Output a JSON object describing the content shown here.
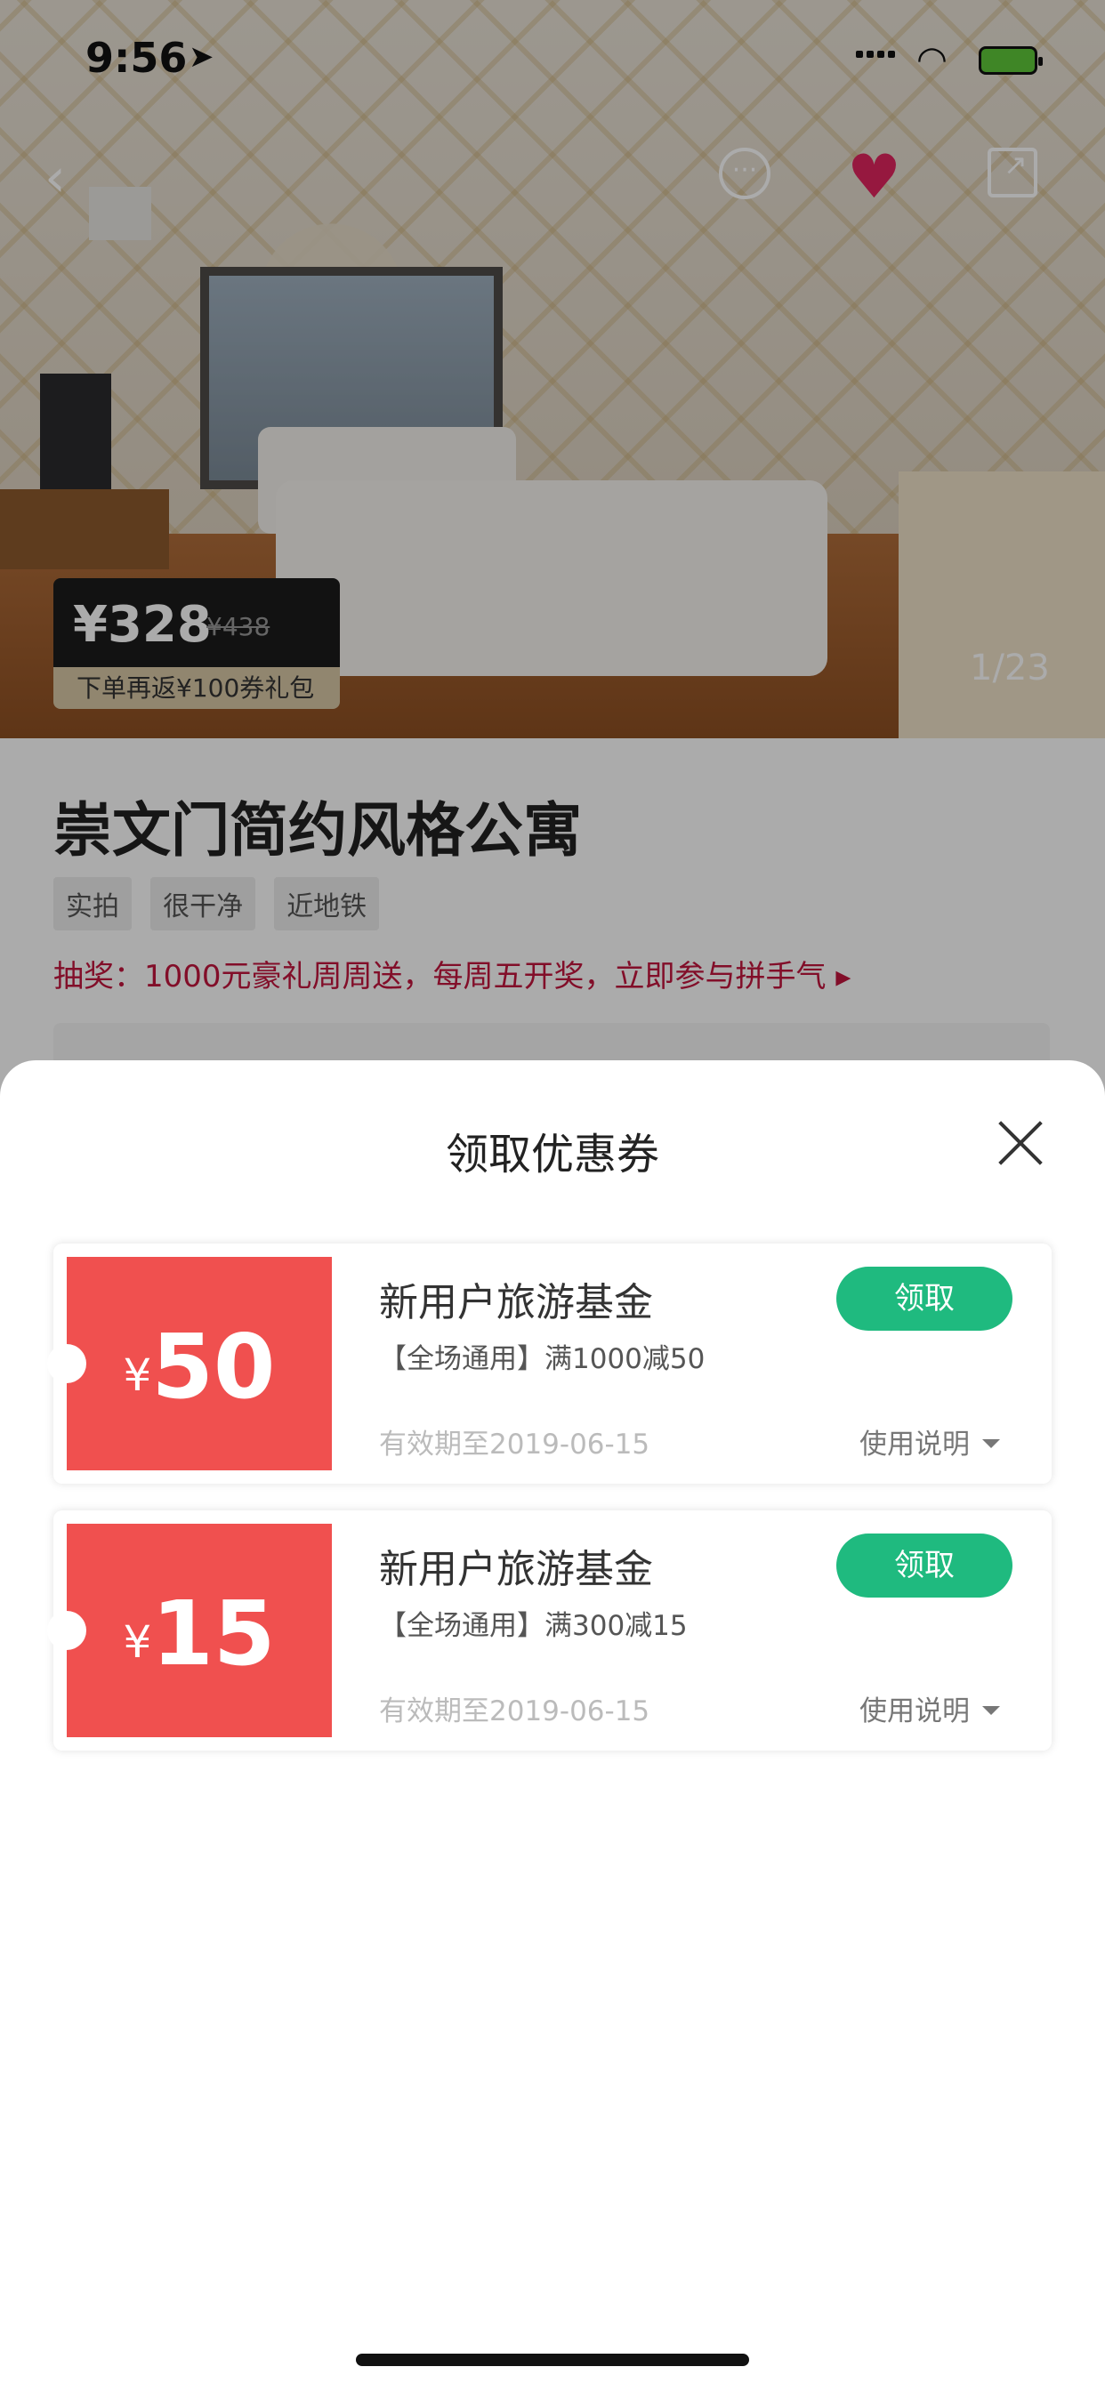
{
  "status_bar": {
    "time": "9:56"
  },
  "listing": {
    "price_current": "¥328",
    "price_original": "¥438",
    "price_note": "下单再返¥100券礼包",
    "photo_counter": "1/23",
    "title": "崇文门简约风格公寓",
    "tags": [
      "实拍",
      "很干净",
      "近地铁"
    ],
    "lottery_text": "抽奖：1000元豪礼周周送，每周五开奖，立即参与拼手气 ▸"
  },
  "coupon_sheet": {
    "title": "领取优惠券",
    "coupons": [
      {
        "currency": "¥",
        "amount": "50",
        "name": "新用户旅游基金",
        "description": "【全场通用】满1000减50",
        "validity": "有效期至2019-06-15",
        "help_label": "使用说明",
        "claim_label": "领取"
      },
      {
        "currency": "¥",
        "amount": "15",
        "name": "新用户旅游基金",
        "description": "【全场通用】满300减15",
        "validity": "有效期至2019-06-15",
        "help_label": "使用说明",
        "claim_label": "领取"
      }
    ]
  },
  "colors": {
    "coupon_red": "#f0504f",
    "claim_green": "#1fba7f",
    "lottery_red": "#c2163e",
    "heart_pink": "#e0245e"
  }
}
